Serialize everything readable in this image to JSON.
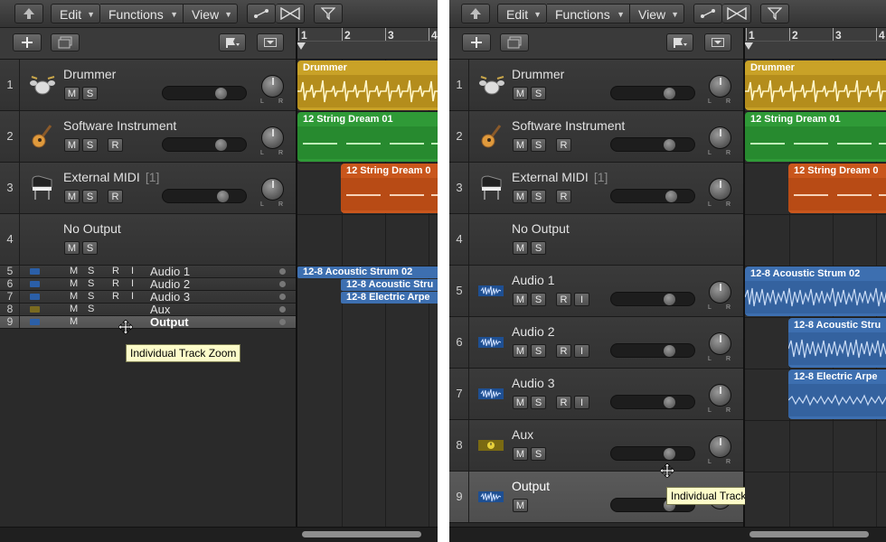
{
  "toolbar": {
    "edit_label": "Edit",
    "functions_label": "Functions",
    "view_label": "View"
  },
  "ruler": {
    "bar_numbers": [
      "1",
      "2",
      "3",
      "4"
    ]
  },
  "tooltip": {
    "text": "Individual Track Zoom"
  },
  "left_panel": {
    "tracks": [
      {
        "number": "1",
        "name": "Drummer",
        "icon": "drum-kit-icon",
        "buttons": [
          "M",
          "S"
        ]
      },
      {
        "number": "2",
        "name": "Software Instrument",
        "icon": "acoustic-guitar-icon",
        "buttons": [
          "M",
          "S",
          "R"
        ]
      },
      {
        "number": "3",
        "name": "External MIDI",
        "extra": "[1]",
        "icon": "grand-piano-icon",
        "buttons": [
          "M",
          "S",
          "R"
        ]
      },
      {
        "number": "4",
        "name": "No Output",
        "icon": "",
        "buttons": [
          "M",
          "S"
        ]
      }
    ],
    "compact_tracks": [
      {
        "number": "5",
        "name": "Audio 1",
        "buttons": [
          "M",
          "S",
          "R",
          "I"
        ]
      },
      {
        "number": "6",
        "name": "Audio 2",
        "buttons": [
          "M",
          "S",
          "R",
          "I"
        ]
      },
      {
        "number": "7",
        "name": "Audio 3",
        "buttons": [
          "M",
          "S",
          "R",
          "I"
        ]
      },
      {
        "number": "8",
        "name": "Aux",
        "buttons": [
          "M",
          "S"
        ]
      },
      {
        "number": "9",
        "name": "Output",
        "buttons": [
          "M"
        ]
      }
    ],
    "regions": [
      {
        "name": "Drummer"
      },
      {
        "name": "12 String Dream 01"
      },
      {
        "name": "12 String Dream 0"
      },
      {
        "name": "12-8 Acoustic Strum 02"
      },
      {
        "name": "12-8 Acoustic Stru"
      },
      {
        "name": "12-8 Electric Arpe"
      }
    ]
  },
  "right_panel": {
    "tracks": [
      {
        "number": "1",
        "name": "Drummer",
        "icon": "drum-kit-icon",
        "buttons": [
          "M",
          "S"
        ]
      },
      {
        "number": "2",
        "name": "Software Instrument",
        "icon": "acoustic-guitar-icon",
        "buttons": [
          "M",
          "S",
          "R"
        ]
      },
      {
        "number": "3",
        "name": "External MIDI",
        "extra": "[1]",
        "icon": "grand-piano-icon",
        "buttons": [
          "M",
          "S",
          "R"
        ]
      },
      {
        "number": "4",
        "name": "No Output",
        "icon": "",
        "buttons": [
          "M",
          "S"
        ]
      },
      {
        "number": "5",
        "name": "Audio 1",
        "icon": "waveform-icon",
        "buttons": [
          "M",
          "S",
          "R",
          "I"
        ]
      },
      {
        "number": "6",
        "name": "Audio 2",
        "icon": "waveform-icon",
        "buttons": [
          "M",
          "S",
          "R",
          "I"
        ]
      },
      {
        "number": "7",
        "name": "Audio 3",
        "icon": "waveform-icon",
        "buttons": [
          "M",
          "S",
          "R",
          "I"
        ]
      },
      {
        "number": "8",
        "name": "Aux",
        "icon": "aux-meter-icon",
        "buttons": [
          "M",
          "S"
        ]
      },
      {
        "number": "9",
        "name": "Output",
        "icon": "waveform-icon",
        "buttons": [
          "M"
        ]
      }
    ],
    "regions": [
      {
        "name": "Drummer"
      },
      {
        "name": "12 String Dream 01"
      },
      {
        "name": "12 String Dream 0"
      },
      {
        "name": "12-8 Acoustic Strum 02"
      },
      {
        "name": "12-8 Acoustic Stru"
      },
      {
        "name": "12-8 Electric Arpe"
      }
    ]
  },
  "colors": {
    "drummer_region": "#c9a227",
    "instrument_region": "#2f9a37",
    "midi_region": "#c9561c",
    "audio_region": "#3d6fb0",
    "tooltip_bg": "#fdfcc9"
  }
}
